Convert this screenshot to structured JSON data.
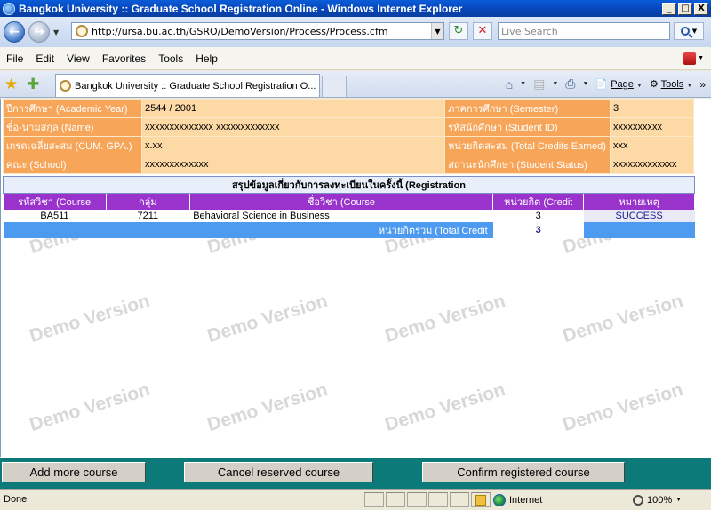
{
  "window": {
    "title": "Bangkok University :: Graduate School Registration Online - Windows Internet Explorer",
    "controls": {
      "minimize": "_",
      "maximize": "□",
      "close": "X"
    }
  },
  "address": {
    "url": "http://ursa.bu.ac.th/GSRO/DemoVersion/Process/Process.cfm",
    "search_placeholder": "Live Search"
  },
  "menu": [
    "File",
    "Edit",
    "View",
    "Favorites",
    "Tools",
    "Help"
  ],
  "tab": {
    "title": "Bangkok University :: Graduate School Registration O..."
  },
  "toolbar": {
    "page_label": "Page",
    "tools_label": "Tools"
  },
  "watermark_text": "Demo Version",
  "student_info": {
    "rows": [
      {
        "label1": "ปีการศึกษา (Academic Year)",
        "value1": "2544 / 2001",
        "label2": "ภาคการศึกษา (Semester)",
        "value2": "3"
      },
      {
        "label1": "ชื่อ-นามสกุล (Name)",
        "value1": "xxxxxxxxxxxxxx xxxxxxxxxxxxx",
        "label2": "รหัสนักศึกษา (Student ID)",
        "value2": "xxxxxxxxxx"
      },
      {
        "label1": "เกรดเฉลี่ยสะสม (CUM. GPA.)",
        "value1": "x.xx",
        "label2": "หน่วยกิตสะสม (Total Credits Earned)",
        "value2": "xxx"
      },
      {
        "label1": "คณะ (School)",
        "value1": "xxxxxxxxxxxxx",
        "label2": "สถานะนักศึกษา (Student Status)",
        "value2": "xxxxxxxxxxxxx"
      }
    ]
  },
  "registration": {
    "title": "สรุปข้อมูลเกี่ยวกับการลงทะเบียนในครั้งนี้ (Registration",
    "headers": [
      "รหัสวิชา (Course",
      "กลุ่ม",
      "ชื่อวิชา (Course",
      "หน่วยกิต (Credit",
      "หมายเหตุ"
    ],
    "rows": [
      {
        "code": "BA511",
        "section": "7211",
        "name": "Behavioral Science in Business",
        "credit": "3",
        "remark": "SUCCESS"
      }
    ],
    "total_label": "หน่วยกิตรวม (Total Credit",
    "total_value": "3"
  },
  "buttons": {
    "add": "Add more course",
    "cancel": "Cancel reserved course",
    "confirm": "Confirm registered course"
  },
  "status": {
    "text": "Done",
    "zone": "Internet",
    "zoom": "100%"
  }
}
